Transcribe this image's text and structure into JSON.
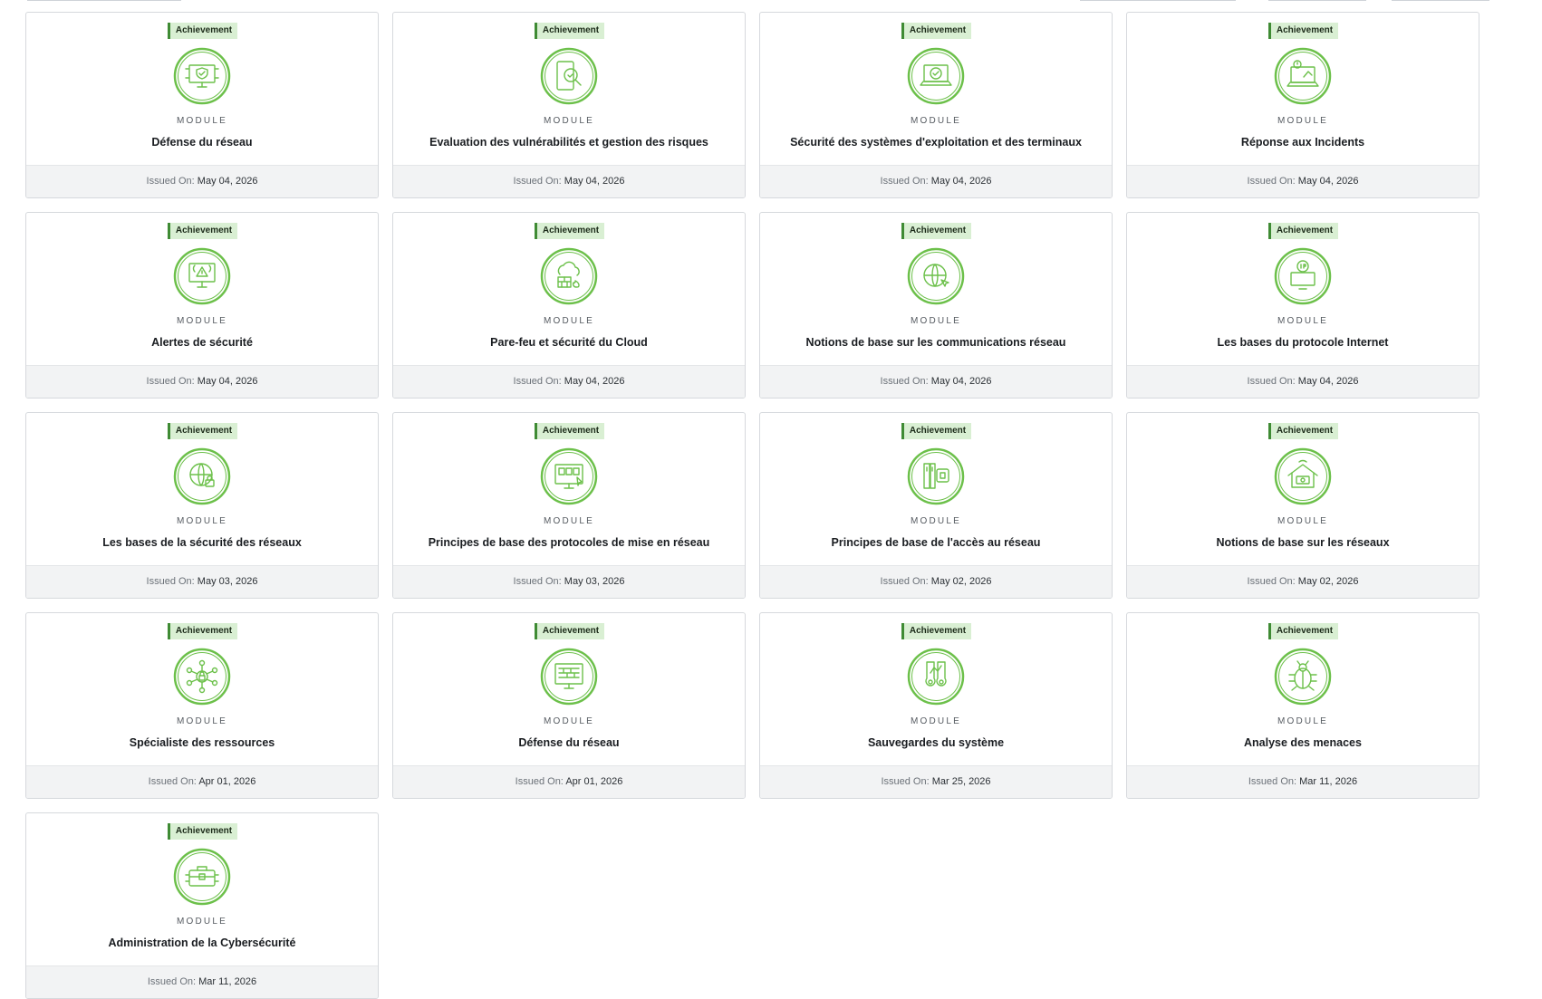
{
  "colors": {
    "accent": "#6cc04a",
    "badge_bg": "#d9efd3",
    "badge_bar": "#3f8b34",
    "footer_bg": "#f2f3f4"
  },
  "cards": [
    {
      "badge": "Achievement",
      "kind": "MODULE",
      "title": "Défense du réseau",
      "issued_label": "Issued On:",
      "issued_date": "May 04, 2026",
      "icon": "network-defense-monitor-icon"
    },
    {
      "badge": "Achievement",
      "kind": "MODULE",
      "title": "Evaluation des vulnérabilités et gestion des risques",
      "issued_label": "Issued On:",
      "issued_date": "May 04, 2026",
      "icon": "vulnerability-magnifier-icon"
    },
    {
      "badge": "Achievement",
      "kind": "MODULE",
      "title": "Sécurité des systèmes d'exploitation et des terminaux",
      "issued_label": "Issued On:",
      "issued_date": "May 04, 2026",
      "icon": "endpoint-laptop-icon"
    },
    {
      "badge": "Achievement",
      "kind": "MODULE",
      "title": "Réponse aux Incidents",
      "issued_label": "Issued On:",
      "issued_date": "May 04, 2026",
      "icon": "incident-response-laptop-icon"
    },
    {
      "badge": "Achievement",
      "kind": "MODULE",
      "title": "Alertes de sécurité",
      "issued_label": "Issued On:",
      "issued_date": "May 04, 2026",
      "icon": "security-alert-monitor-icon"
    },
    {
      "badge": "Achievement",
      "kind": "MODULE",
      "title": "Pare-feu et sécurité du Cloud",
      "issued_label": "Issued On:",
      "issued_date": "May 04, 2026",
      "icon": "cloud-firewall-icon"
    },
    {
      "badge": "Achievement",
      "kind": "MODULE",
      "title": "Notions de base sur les communications réseau",
      "issued_label": "Issued On:",
      "issued_date": "May 04, 2026",
      "icon": "globe-cursor-icon"
    },
    {
      "badge": "Achievement",
      "kind": "MODULE",
      "title": "Les bases du protocole Internet",
      "issued_label": "Issued On:",
      "issued_date": "May 04, 2026",
      "icon": "ip-monitor-icon"
    },
    {
      "badge": "Achievement",
      "kind": "MODULE",
      "title": "Les bases de la sécurité des réseaux",
      "issued_label": "Issued On:",
      "issued_date": "May 03, 2026",
      "icon": "globe-lock-icon"
    },
    {
      "badge": "Achievement",
      "kind": "MODULE",
      "title": "Principes de base des protocoles de mise en réseau",
      "issued_label": "Issued On:",
      "issued_date": "May 03, 2026",
      "icon": "protocol-monitor-icon"
    },
    {
      "badge": "Achievement",
      "kind": "MODULE",
      "title": "Principes de base de l'accès au réseau",
      "issued_label": "Issued On:",
      "issued_date": "May 02, 2026",
      "icon": "network-access-device-icon"
    },
    {
      "badge": "Achievement",
      "kind": "MODULE",
      "title": "Notions de base sur les réseaux",
      "issued_label": "Issued On:",
      "issued_date": "May 02, 2026",
      "icon": "home-network-icon"
    },
    {
      "badge": "Achievement",
      "kind": "MODULE",
      "title": "Spécialiste des ressources",
      "issued_label": "Issued On:",
      "issued_date": "Apr 01, 2026",
      "icon": "resource-hub-lock-icon"
    },
    {
      "badge": "Achievement",
      "kind": "MODULE",
      "title": "Défense du réseau",
      "issued_label": "Issued On:",
      "issued_date": "Apr 01, 2026",
      "icon": "firewall-monitor-icon"
    },
    {
      "badge": "Achievement",
      "kind": "MODULE",
      "title": "Sauvegardes du système",
      "issued_label": "Issued On:",
      "issued_date": "Mar 25, 2026",
      "icon": "backup-keys-icon"
    },
    {
      "badge": "Achievement",
      "kind": "MODULE",
      "title": "Analyse des menaces",
      "issued_label": "Issued On:",
      "issued_date": "Mar 11, 2026",
      "icon": "bug-threat-icon"
    },
    {
      "badge": "Achievement",
      "kind": "MODULE",
      "title": "Administration de la Cybersécurité",
      "issued_label": "Issued On:",
      "issued_date": "Mar 11, 2026",
      "icon": "admin-briefcase-icon"
    }
  ]
}
